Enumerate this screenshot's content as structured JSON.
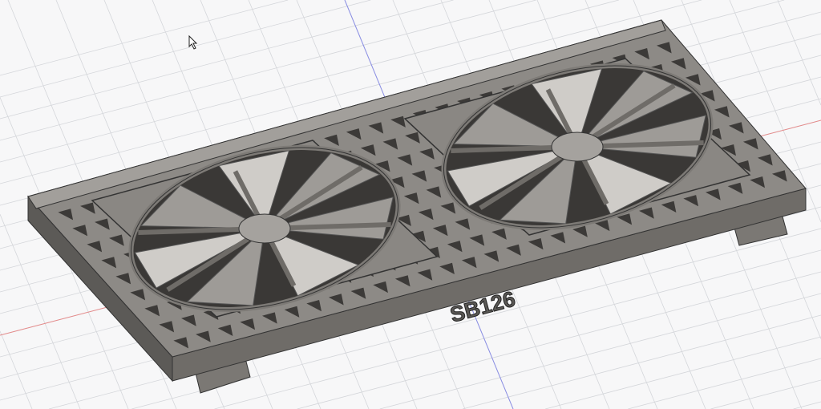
{
  "viewport": {
    "model_label": "SB126",
    "icons": [
      "mouse-cursor-icon"
    ],
    "colors": {
      "background": "#f7f7f8",
      "grid": "#d4d6da",
      "x_axis": "#e48a8a",
      "y_axis": "#8a8ee4",
      "body_top": "#8d8a86",
      "body_side": "#6f6c68",
      "body_dark": "#4e4c49",
      "fan_light": "#d8d6d3"
    }
  }
}
